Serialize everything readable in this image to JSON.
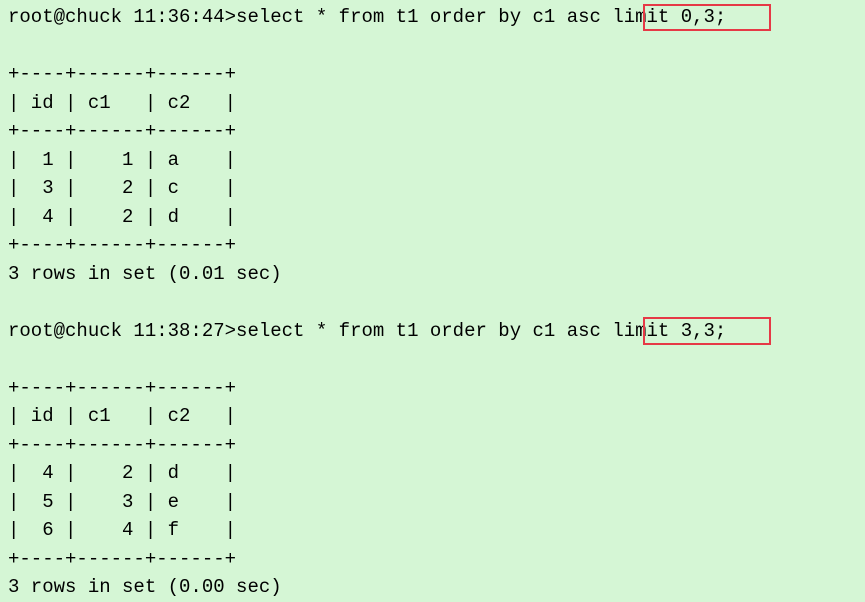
{
  "query1": {
    "prompt_prefix": "root@chuck 11:36:44>",
    "prompt_query_before": "select * from t1 order by c1 asc ",
    "prompt_query_highlight": "limit 0,3;",
    "border": "+----+------+------+",
    "header": "| id | c1   | c2   |",
    "rows": [
      "|  1 |    1 | a    |",
      "|  3 |    2 | c    |",
      "|  4 |    2 | d    |"
    ],
    "summary": "3 rows in set (0.01 sec)"
  },
  "query2": {
    "prompt_prefix": "root@chuck 11:38:27>",
    "prompt_query_before": "select * from t1 order by c1 asc ",
    "prompt_query_highlight": "limit 3,3;",
    "border": "+----+------+------+",
    "header": "| id | c1   | c2   |",
    "rows": [
      "|  4 |    2 | d    |",
      "|  5 |    3 | e    |",
      "|  6 |    4 | f    |"
    ],
    "summary": "3 rows in set (0.00 sec)"
  }
}
